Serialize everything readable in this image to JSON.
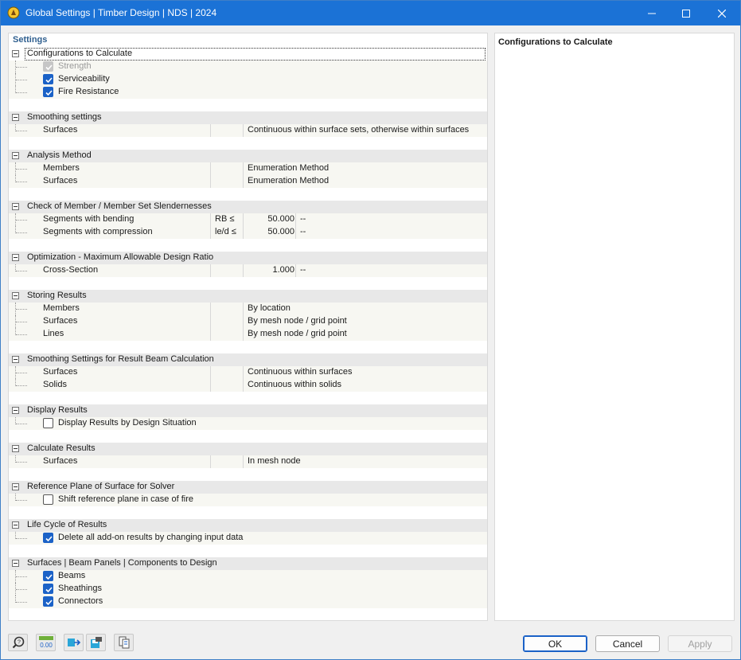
{
  "window": {
    "title": "Global Settings | Timber Design | NDS | 2024",
    "controls": {
      "minimize": "minimize-icon",
      "maximize": "maximize-icon",
      "close": "close-icon"
    }
  },
  "settings": {
    "header": "Settings",
    "groups": [
      {
        "label": "Configurations to Calculate",
        "items": [
          {
            "type": "check",
            "label": "Strength",
            "checked": true,
            "disabled": true
          },
          {
            "type": "check",
            "label": "Serviceability",
            "checked": true
          },
          {
            "type": "check",
            "label": "Fire Resistance",
            "checked": true
          }
        ]
      },
      {
        "label": "Smoothing settings",
        "items": [
          {
            "type": "text",
            "label": "Surfaces",
            "value": "Continuous within surface sets, otherwise within surfaces"
          }
        ]
      },
      {
        "label": "Analysis Method",
        "items": [
          {
            "type": "text",
            "label": "Members",
            "value": "Enumeration Method"
          },
          {
            "type": "text",
            "label": "Surfaces",
            "value": "Enumeration Method"
          }
        ]
      },
      {
        "label": "Check of Member / Member Set Slendernesses",
        "items": [
          {
            "type": "num",
            "label": "Segments with bending",
            "symbol": "RB ≤",
            "value": "50.000",
            "unit": "--"
          },
          {
            "type": "num",
            "label": "Segments with compression",
            "symbol": "le/d ≤",
            "value": "50.000",
            "unit": "--"
          }
        ]
      },
      {
        "label": "Optimization - Maximum Allowable Design Ratio",
        "items": [
          {
            "type": "num",
            "label": "Cross-Section",
            "symbol": "",
            "value": "1.000",
            "unit": "--"
          }
        ]
      },
      {
        "label": "Storing Results",
        "items": [
          {
            "type": "text",
            "label": "Members",
            "value": "By location"
          },
          {
            "type": "text",
            "label": "Surfaces",
            "value": "By mesh node / grid point"
          },
          {
            "type": "text",
            "label": "Lines",
            "value": "By mesh node / grid point"
          }
        ]
      },
      {
        "label": "Smoothing Settings for Result Beam Calculation",
        "items": [
          {
            "type": "text",
            "label": "Surfaces",
            "value": "Continuous within surfaces"
          },
          {
            "type": "text",
            "label": "Solids",
            "value": "Continuous within solids"
          }
        ]
      },
      {
        "label": "Display Results",
        "items": [
          {
            "type": "check",
            "label": "Display Results by Design Situation",
            "checked": false
          }
        ]
      },
      {
        "label": "Calculate Results",
        "items": [
          {
            "type": "text",
            "label": "Surfaces",
            "value": "In mesh node"
          }
        ]
      },
      {
        "label": "Reference Plane of Surface for Solver",
        "items": [
          {
            "type": "check",
            "label": "Shift reference plane in case of fire",
            "checked": false
          }
        ]
      },
      {
        "label": "Life Cycle of Results",
        "items": [
          {
            "type": "check",
            "label": "Delete all add-on results by changing input data",
            "checked": true
          }
        ]
      },
      {
        "label": "Surfaces | Beam Panels | Components to Design",
        "items": [
          {
            "type": "check",
            "label": "Beams",
            "checked": true
          },
          {
            "type": "check",
            "label": "Sheathings",
            "checked": true
          },
          {
            "type": "check",
            "label": "Connectors",
            "checked": true
          }
        ]
      }
    ]
  },
  "info": {
    "title": "Configurations to Calculate"
  },
  "toolbar": {
    "tools": [
      "help-icon",
      "units-icon",
      "export-icon",
      "save-defaults-icon",
      "copy-settings-icon"
    ],
    "units_text": "0.00"
  },
  "buttons": {
    "ok": "OK",
    "cancel": "Cancel",
    "apply": "Apply"
  },
  "colors": {
    "titlebar": "#1b72d6",
    "accent": "#1b62c7",
    "group_row": "#e8e8e8"
  }
}
